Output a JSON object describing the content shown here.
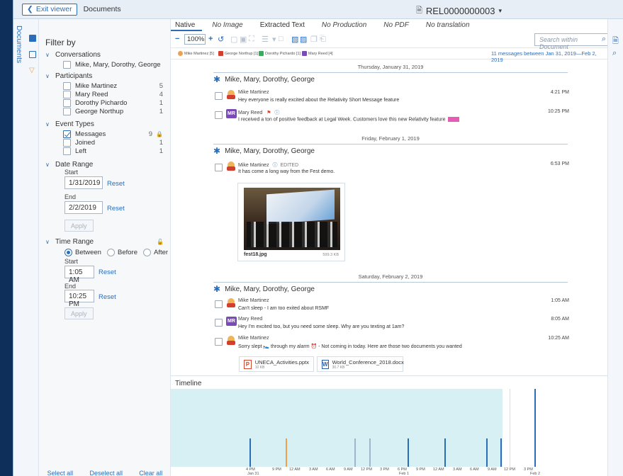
{
  "topbar": {
    "exit_label": "Exit viewer",
    "documents_label": "Documents",
    "doc_id": "REL0000000003"
  },
  "rail": {
    "documents_label": "Documents"
  },
  "filter": {
    "title": "Filter by",
    "conversations": {
      "label": "Conversations",
      "items": [
        {
          "name": "Mike, Mary, Dorothy, George",
          "checked": false
        }
      ]
    },
    "participants": {
      "label": "Participants",
      "items": [
        {
          "name": "Mike Martinez",
          "count": "5"
        },
        {
          "name": "Mary Reed",
          "count": "4"
        },
        {
          "name": "Dorothy Pichardo",
          "count": "1"
        },
        {
          "name": "George Northup",
          "count": "1"
        }
      ]
    },
    "event_types": {
      "label": "Event Types",
      "items": [
        {
          "name": "Messages",
          "count": "9",
          "checked": true
        },
        {
          "name": "Joined",
          "count": "1",
          "checked": false
        },
        {
          "name": "Left",
          "count": "1",
          "checked": false
        }
      ]
    },
    "date_range": {
      "label": "Date Range",
      "start_label": "Start",
      "start_value": "1/31/2019",
      "end_label": "End",
      "end_value": "2/2/2019",
      "reset": "Reset",
      "apply": "Apply"
    },
    "time_range": {
      "label": "Time Range",
      "between": "Between",
      "before": "Before",
      "after": "After",
      "start_label": "Start",
      "start_value": "1:05 AM",
      "end_label": "End",
      "end_value": "10:25 PM",
      "reset": "Reset",
      "apply": "Apply"
    },
    "footer": {
      "select_all": "Select all",
      "deselect_all": "Deselect all",
      "clear_all": "Clear all"
    }
  },
  "tabs": [
    {
      "label": "Native",
      "italic": false,
      "active": true
    },
    {
      "label": "No Image",
      "italic": true,
      "active": false
    },
    {
      "label": "Extracted Text",
      "italic": false,
      "active": false
    },
    {
      "label": "No Production",
      "italic": true,
      "active": false
    },
    {
      "label": "No PDF",
      "italic": true,
      "active": false
    },
    {
      "label": "No translation",
      "italic": true,
      "active": false
    }
  ],
  "toolbar": {
    "zoom": "100%",
    "search_placeholder": "Search within Document"
  },
  "participants_bar": {
    "chips": [
      {
        "label": "Mike Martinez [5]",
        "color": "#f0a04b"
      },
      {
        "label": "George Northup [1]",
        "color": "#d23f2f"
      },
      {
        "label": "Dorothy Pichardo [1]",
        "color": "#3aaa5c"
      },
      {
        "label": "Mary Reed [4]",
        "color": "#7a4bb5"
      }
    ],
    "summary": "11 messages between Jan 31, 2019—Feb 2, 2019"
  },
  "conversation": {
    "days": [
      {
        "date": "Thursday, January 31, 2019",
        "group": "Mike, Mary, Dorothy, George",
        "messages": [
          {
            "author": "Mike Martinez",
            "text": "Hey everyone is really excited about the Relativity Short Message feature",
            "time": "4:21 PM",
            "avatar": "face"
          },
          {
            "author": "Mary Reed",
            "text": "I received a ton of positive feedback at Legal Week.  Customers love this new Relativity feature",
            "time": "10:25 PM",
            "avatar": "MR"
          }
        ]
      },
      {
        "date": "Friday, February 1, 2019",
        "group": "Mike, Mary, Dorothy, George",
        "messages": [
          {
            "author": "Mike Martinez",
            "edited": "EDITED",
            "text": "It has come a long way from the Fest demo.",
            "time": "6:53 PM",
            "avatar": "face",
            "attachment": {
              "name": "fest18.jpg",
              "size": "599.3 KB"
            }
          }
        ]
      },
      {
        "date": "Saturday, February 2, 2019",
        "group": "Mike, Mary, Dorothy, George",
        "messages": [
          {
            "author": "Mike Martinez",
            "text": "Can't sleep - I am too exited about RSMF",
            "time": "1:05 AM",
            "avatar": "face"
          },
          {
            "author": "Mary Reed",
            "text": "Hey I'm excited too, but you need some sleep.  Why are you texting at 1am?",
            "time": "8:05 AM",
            "avatar": "MR"
          },
          {
            "author": "Mike Martinez",
            "text": "Sorry slept 🛌 through my alarm ⏰ - Not coming in today. Here are those two documents you wanted",
            "time": "10:25 AM",
            "avatar": "face",
            "files": [
              {
                "name": "UNECA_Activities.pptx",
                "size": "10 KB",
                "type": "P"
              },
              {
                "name": "World_Conference_2018.docx",
                "size": "30.7 KB",
                "type": "W"
              }
            ]
          }
        ]
      }
    ]
  },
  "timeline": {
    "title": "Timeline",
    "ticks": [
      "4 PM",
      "9 PM",
      "12 AM",
      "3 AM",
      "6 AM",
      "9 AM",
      "12 PM",
      "3 PM",
      "6 PM",
      "9 PM",
      "12 AM",
      "3 AM",
      "6 AM",
      "9 AM",
      "12 PM",
      "3 PM"
    ],
    "day_labels": [
      "Jan 31",
      "Feb 1",
      "Feb 2"
    ]
  }
}
